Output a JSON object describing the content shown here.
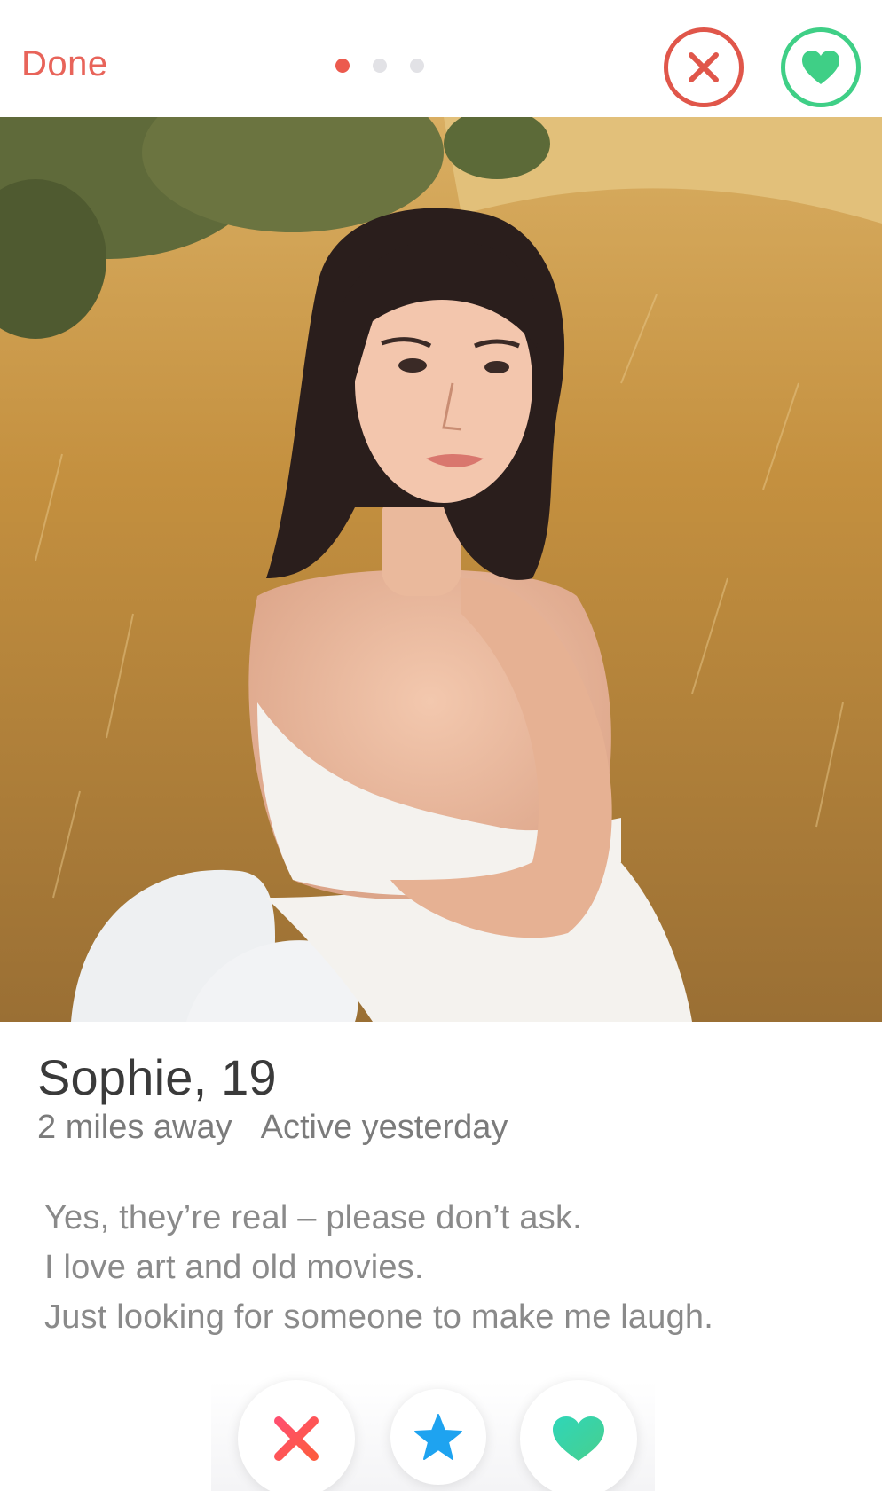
{
  "header": {
    "done_label": "Done",
    "pager": {
      "count": 3,
      "active_index": 0
    },
    "pass_icon": "close-circle-icon",
    "like_icon": "heart-circle-icon"
  },
  "profile": {
    "name_age": "Sophie, 19",
    "distance": "2 miles away",
    "activity": "Active yesterday",
    "bio": [
      "Yes, they’re real – please don’t ask.",
      "I love art and old movies.",
      "Just looking for someone to make me laugh."
    ]
  },
  "actions": {
    "pass_icon": "close-icon",
    "super_like_icon": "star-icon",
    "like_icon": "heart-icon"
  },
  "colors": {
    "accent_red": "#e0564a",
    "accent_green": "#3fcf86",
    "star_blue": "#1ea3f0",
    "like_teal": "#35d2a8",
    "text_dark": "#3a3a3a",
    "text_gray": "#7b7b7b"
  }
}
